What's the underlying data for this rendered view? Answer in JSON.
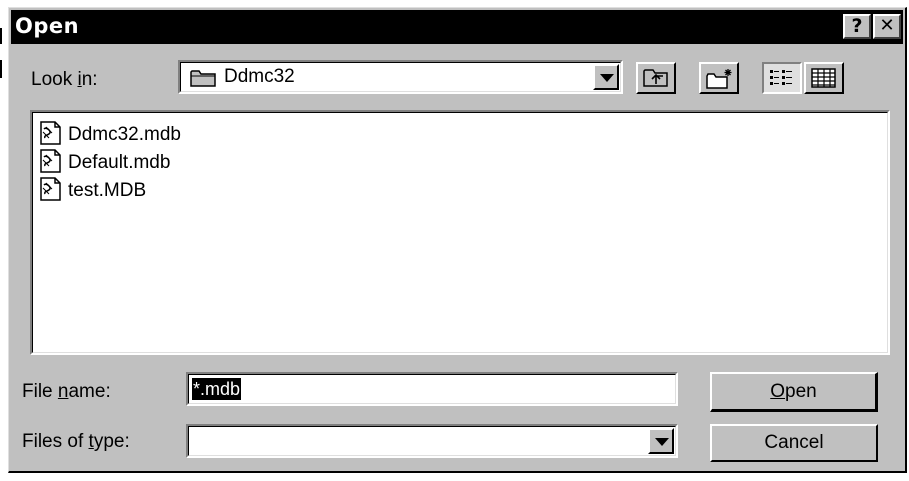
{
  "dialog": {
    "title": "Open",
    "help_label": "?",
    "close_label": "✕"
  },
  "look_in": {
    "label_pre": "Look ",
    "label_u": "i",
    "label_post": "n:",
    "value": "Ddmc32"
  },
  "toolbar": {
    "up_one_level_icon": "up-folder-icon",
    "new_folder_icon": "new-folder-icon",
    "list_view_icon": "list-view-icon",
    "details_view_icon": "details-view-icon"
  },
  "files": [
    {
      "name": "Ddmc32.mdb",
      "icon": "database-file-icon"
    },
    {
      "name": "Default.mdb",
      "icon": "database-file-icon"
    },
    {
      "name": "test.MDB",
      "icon": "database-file-icon"
    }
  ],
  "file_name": {
    "label_pre": "File ",
    "label_u": "n",
    "label_post": "ame:",
    "value": "*.mdb"
  },
  "files_of_type": {
    "label_pre": "Files of ",
    "label_u": "t",
    "label_post": "ype:",
    "value": ""
  },
  "buttons": {
    "open_u": "O",
    "open_rest": "pen",
    "cancel": "Cancel"
  },
  "colors": {
    "face": "#c0c0c0",
    "title_bar": "#000000",
    "selection": "#000080"
  }
}
